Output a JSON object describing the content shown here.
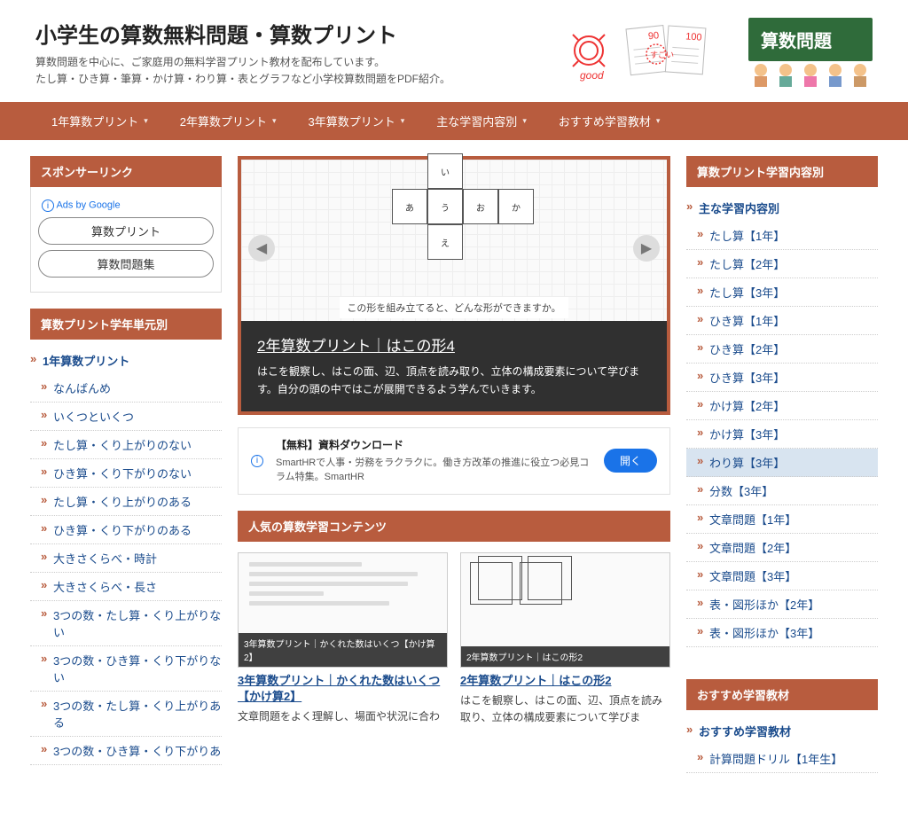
{
  "header": {
    "title": "小学生の算数無料問題・算数プリント",
    "desc1": "算数問題を中心に、ご家庭用の無料学習プリント教材を配布しています。",
    "desc2": "たし算・ひき算・筆算・かけ算・わり算・表とグラフなど小学校算数問題をPDF紹介。",
    "badge": "算数問題"
  },
  "nav": [
    "1年算数プリント",
    "2年算数プリント",
    "3年算数プリント",
    "主な学習内容別",
    "おすすめ学習教材"
  ],
  "left": {
    "sponsor_h": "スポンサーリンク",
    "ads_info": "Ads by Google",
    "ad_pills": [
      "算数プリント",
      "算数問題集"
    ],
    "units_h": "算数プリント学年単元別",
    "units_top": "1年算数プリント",
    "units": [
      "なんばんめ",
      "いくつといくつ",
      "たし算・くり上がりのない",
      "ひき算・くり下がりのない",
      "たし算・くり上がりのある",
      "ひき算・くり下がりのある",
      "大きさくらべ・時計",
      "大きさくらべ・長さ",
      "3つの数・たし算・くり上がりない",
      "3つの数・ひき算・くり下がりない",
      "3つの数・たし算・くり上がりある",
      "3つの数・ひき算・くり下がりあ"
    ]
  },
  "slider": {
    "cells": [
      "い",
      "あ",
      "う",
      "お",
      "か",
      "え"
    ],
    "question": "この形を組み立てると、どんな形ができますか。",
    "title": "2年算数プリント｜はこの形4",
    "desc": "はこを観察し、はこの面、辺、頂点を読み取り、立体の構成要素について学びます。自分の頭の中ではこが展開できるよう学んでいきます。"
  },
  "inline_ad": {
    "title": "【無料】資料ダウンロード",
    "body": "SmartHRで人事・労務をラクラクに。働き方改革の推進に役立つ必見コラム特集。SmartHR",
    "button": "開く"
  },
  "popular": {
    "heading": "人気の算数学習コンテンツ",
    "cards": [
      {
        "thumb_cap": "3年算数プリント｜かくれた数はいくつ【かけ算2】",
        "title": "3年算数プリント｜かくれた数はいくつ【かけ算2】",
        "desc": "文章問題をよく理解し、場面や状況に合わ"
      },
      {
        "thumb_cap": "2年算数プリント｜はこの形2",
        "title": "2年算数プリント｜はこの形2",
        "desc": "はこを観察し、はこの面、辺、頂点を読み取り、立体の構成要素について学びま"
      }
    ]
  },
  "right": {
    "cat_h": "算数プリント学習内容別",
    "cat_top": "主な学習内容別",
    "cats": [
      "たし算【1年】",
      "たし算【2年】",
      "たし算【3年】",
      "ひき算【1年】",
      "ひき算【2年】",
      "ひき算【3年】",
      "かけ算【2年】",
      "かけ算【3年】",
      "わり算【3年】",
      "分数【3年】",
      "文章問題【1年】",
      "文章問題【2年】",
      "文章問題【3年】",
      "表・図形ほか【2年】",
      "表・図形ほか【3年】"
    ],
    "cat_highlight_index": 8,
    "rec_h": "おすすめ学習教材",
    "rec_top": "おすすめ学習教材",
    "recs": [
      "計算問題ドリル【1年生】"
    ]
  }
}
